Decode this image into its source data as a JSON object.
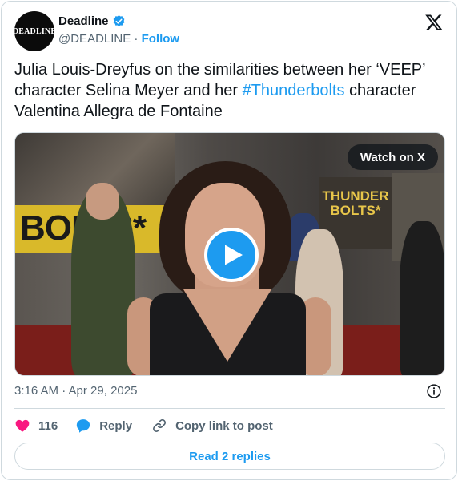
{
  "author": {
    "avatar_text": "DEADLINE",
    "name": "Deadline",
    "handle": "@DEADLINE",
    "separator": " · ",
    "follow_label": "Follow"
  },
  "tweet": {
    "text_before": "Julia Louis-Dreyfus on the similarities between her ‘VEEP’ character Selina Meyer and her ",
    "hashtag": "#Thunderbolts",
    "text_after": " character Valentina Allegra de Fontaine"
  },
  "media": {
    "watch_label": "Watch on X",
    "poster_left_text": "BOLTS*",
    "poster_right_text": "THUNDER BOLTS*"
  },
  "timestamp": "3:16 AM · Apr 29, 2025",
  "actions": {
    "like_count": "116",
    "reply_label": "Reply",
    "copy_label": "Copy link to post"
  },
  "read_replies_label": "Read 2 replies",
  "colors": {
    "accent": "#1d9bf0",
    "like": "#f91880",
    "secondary_text": "#536471"
  }
}
